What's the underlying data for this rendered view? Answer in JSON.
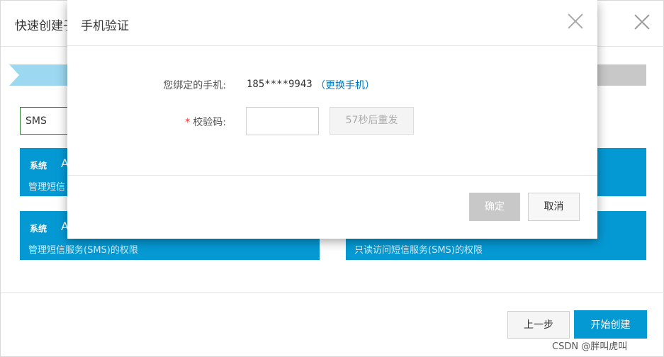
{
  "background_modal": {
    "title": "快速创建子",
    "steps_bar": {
      "active_color": "#9cd8f0",
      "inactive_color": "#c8c8c8"
    },
    "search": {
      "value": "SMS"
    },
    "cards": [
      {
        "tag": "系统",
        "name": "A",
        "desc": "管理短信",
        "color": "#0599d4"
      },
      {
        "tag": "",
        "name": "",
        "desc": "",
        "color": "#0599d4"
      },
      {
        "tag": "系统",
        "name": "A",
        "desc": "管理短信服务(SMS)的权限",
        "color": "#0599d4"
      },
      {
        "tag": "",
        "name": "",
        "desc": "只读访问短信服务(SMS)的权限",
        "color": "#0599d4"
      }
    ],
    "footer": {
      "prev_label": "上一步",
      "create_label": "开始创建"
    },
    "watermark": "CSDN @胖叫虎叫"
  },
  "dialog": {
    "title": "手机验证",
    "phone_label": "您绑定的手机:",
    "phone_value": "185****9943",
    "change_phone_label": "（更换手机）",
    "code_label": "校验码:",
    "required_star": "*",
    "code_value": "",
    "resend_label": "57秒后重发",
    "confirm_label": "确定",
    "cancel_label": "取消"
  },
  "colors": {
    "primary": "#0599d4",
    "link": "#0277bd",
    "required": "#e53935",
    "disabled": "#c8c8c8"
  }
}
